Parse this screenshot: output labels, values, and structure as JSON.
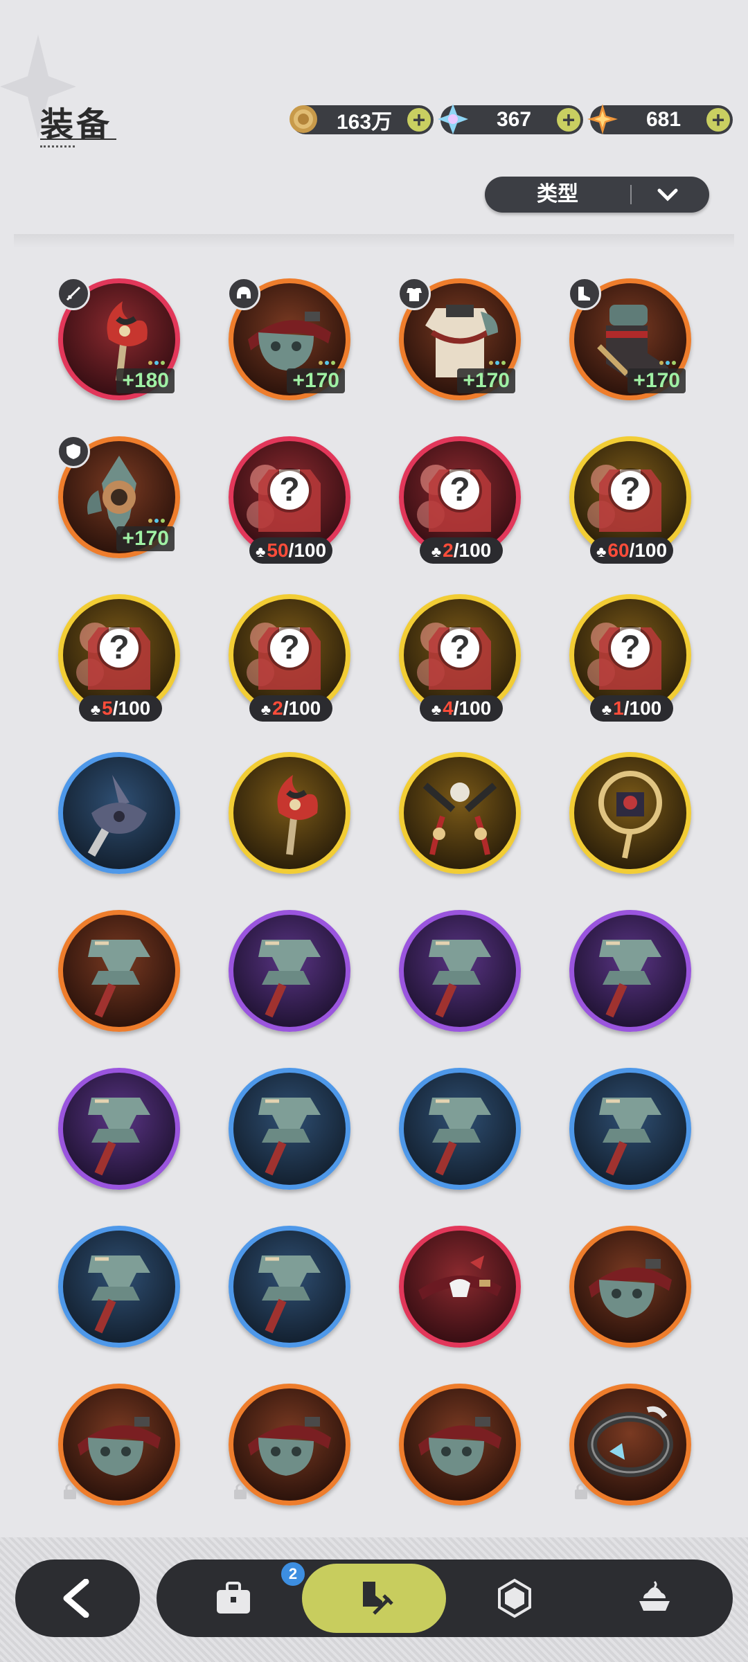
{
  "header": {
    "title": "装备"
  },
  "currencies": [
    {
      "name": "coin-icon",
      "value": "163万",
      "color": "#d7b36a"
    },
    {
      "name": "crystal-icon",
      "value": "367",
      "color": "#9fe0ff"
    },
    {
      "name": "star-gem-icon",
      "value": "681",
      "color": "#f0a040"
    }
  ],
  "filter": {
    "label": "类型"
  },
  "items": [
    {
      "rarity": "red",
      "art": "red-staff",
      "slot": "sword-icon",
      "level": "+180",
      "dots": 3
    },
    {
      "rarity": "orange",
      "art": "belt",
      "slot": "helmet-icon",
      "level": "+170",
      "dots": 3
    },
    {
      "rarity": "orange",
      "art": "armor",
      "slot": "armor-icon",
      "level": "+170",
      "dots": 3
    },
    {
      "rarity": "orange",
      "art": "boots",
      "slot": "boots-icon",
      "level": "+170",
      "dots": 3
    },
    {
      "rarity": "orange",
      "art": "amulet",
      "slot": "shield-icon",
      "level": "+170",
      "dots": 3
    },
    {
      "rarity": "red",
      "art": "outfit-unknown",
      "fragment": {
        "current": "50",
        "total": "/100"
      }
    },
    {
      "rarity": "red",
      "art": "outfit-unknown",
      "fragment": {
        "current": "2",
        "total": "/100"
      }
    },
    {
      "rarity": "gold",
      "art": "outfit-unknown",
      "fragment": {
        "current": "60",
        "total": "/100"
      }
    },
    {
      "rarity": "gold",
      "art": "outfit-unknown",
      "fragment": {
        "current": "5",
        "total": "/100"
      }
    },
    {
      "rarity": "gold",
      "art": "outfit-unknown",
      "fragment": {
        "current": "2",
        "total": "/100"
      }
    },
    {
      "rarity": "gold",
      "art": "outfit-unknown",
      "fragment": {
        "current": "4",
        "total": "/100"
      }
    },
    {
      "rarity": "gold",
      "art": "outfit-unknown",
      "fragment": {
        "current": "1",
        "total": "/100"
      }
    },
    {
      "rarity": "blue",
      "art": "horn-weapon"
    },
    {
      "rarity": "gold",
      "art": "red-staff"
    },
    {
      "rarity": "gold",
      "art": "twin-blades"
    },
    {
      "rarity": "gold",
      "art": "ornate-staff"
    },
    {
      "rarity": "orange",
      "art": "hammer"
    },
    {
      "rarity": "purple",
      "art": "hammer"
    },
    {
      "rarity": "purple",
      "art": "hammer"
    },
    {
      "rarity": "purple",
      "art": "hammer"
    },
    {
      "rarity": "purple",
      "art": "hammer"
    },
    {
      "rarity": "blue",
      "art": "hammer"
    },
    {
      "rarity": "blue",
      "art": "hammer"
    },
    {
      "rarity": "blue",
      "art": "hammer"
    },
    {
      "rarity": "blue",
      "art": "hammer"
    },
    {
      "rarity": "blue",
      "art": "hammer"
    },
    {
      "rarity": "red",
      "art": "ribbon-belt"
    },
    {
      "rarity": "orange",
      "art": "belt"
    },
    {
      "rarity": "orange",
      "art": "belt",
      "locked": true
    },
    {
      "rarity": "orange",
      "art": "belt",
      "locked": true
    },
    {
      "rarity": "orange",
      "art": "belt"
    },
    {
      "rarity": "orange",
      "art": "ring-band",
      "locked": true
    }
  ],
  "nav": {
    "badge": "2",
    "items": [
      "back-icon",
      "briefcase-icon",
      "equipment-icon",
      "hexagon-icon",
      "dessert-icon"
    ]
  }
}
